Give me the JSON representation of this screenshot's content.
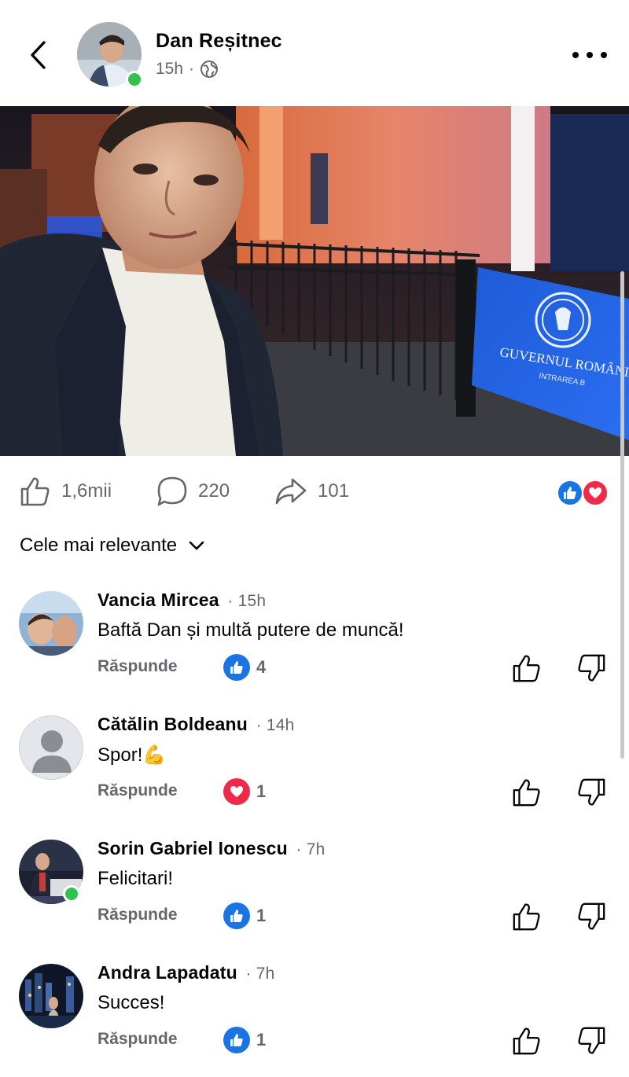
{
  "post": {
    "author": "Dan Reșitnec",
    "time": "15h",
    "separator": "·",
    "photo": {
      "sign_title": "GUVERNUL ROMÂNIEI",
      "sign_subtitle": "INTRAREA B",
      "seal_text": "GUVERNUL ROMÂNIEI"
    }
  },
  "actions": {
    "likes": "1,6mii",
    "comments": "220",
    "shares": "101",
    "reaction_icons": [
      "like-icon",
      "love-icon"
    ]
  },
  "sort": {
    "label": "Cele mai relevante"
  },
  "comments": [
    {
      "name": "Vancia Mircea",
      "time": "15h",
      "text": "Baftă Dan și multă putere de muncă!",
      "reply": "Răspunde",
      "reaction": "like",
      "count": "4",
      "online": false
    },
    {
      "name": "Cătălin Boldeanu",
      "time": "14h",
      "text": "Spor!",
      "emoji": "💪",
      "reply": "Răspunde",
      "reaction": "love",
      "count": "1",
      "online": false
    },
    {
      "name": "Sorin Gabriel Ionescu",
      "time": "7h",
      "text": "Felicitari!",
      "reply": "Răspunde",
      "reaction": "like",
      "count": "1",
      "online": true
    },
    {
      "name": "Andra Lapadatu",
      "time": "7h",
      "text": "Succes!",
      "reply": "Răspunde",
      "reaction": "like",
      "count": "1",
      "online": false
    }
  ],
  "colors": {
    "accent_blue": "#1b74e4",
    "love_red": "#f02849",
    "online_green": "#31c24d",
    "secondary_text": "#65676b"
  }
}
